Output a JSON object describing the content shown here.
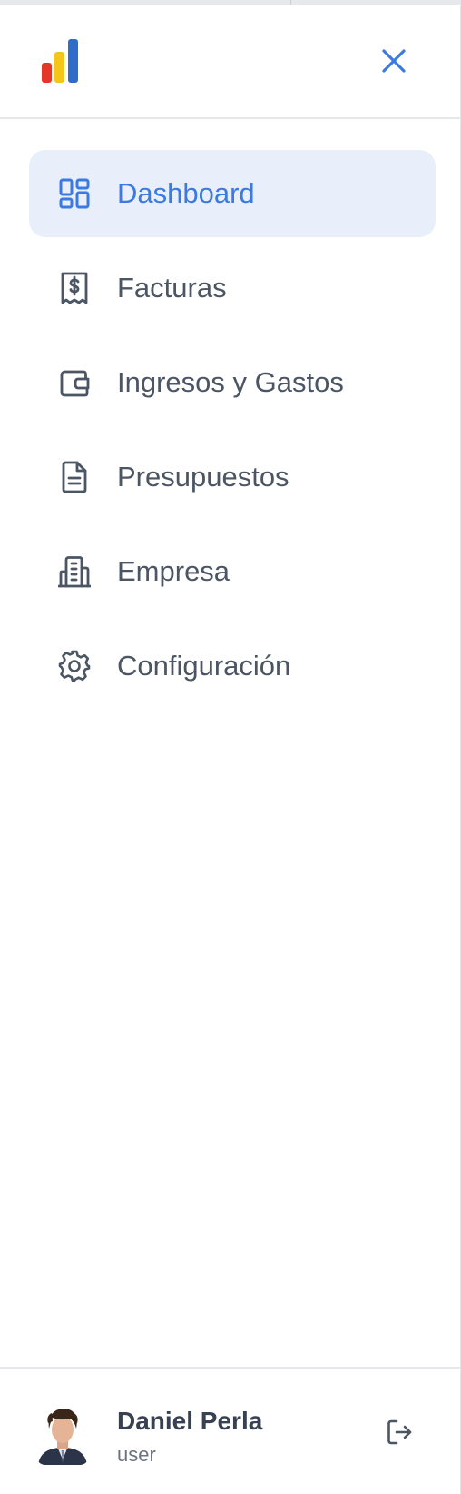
{
  "brand": {
    "logo_icon": "bar-chart-logo-icon",
    "colors": {
      "red": "#e53727",
      "yellow": "#f5c518",
      "blue": "#2f6dc6"
    }
  },
  "header": {
    "close_icon": "close-icon"
  },
  "theme": {
    "accent": "#3b7ae0",
    "active_bg": "#e8effb",
    "text": "#4b5563",
    "divider": "#e5e7eb"
  },
  "nav": {
    "items": [
      {
        "label": "Dashboard",
        "icon": "dashboard-grid-icon",
        "active": true
      },
      {
        "label": "Facturas",
        "icon": "receipt-dollar-icon",
        "active": false
      },
      {
        "label": "Ingresos y Gastos",
        "icon": "wallet-icon",
        "active": false
      },
      {
        "label": "Presupuestos",
        "icon": "document-icon",
        "active": false
      },
      {
        "label": "Empresa",
        "icon": "building-icon",
        "active": false
      },
      {
        "label": "Configuración",
        "icon": "gear-icon",
        "active": false
      }
    ]
  },
  "user": {
    "name": "Daniel Perla",
    "role": "user",
    "avatar_icon": "avatar-photo",
    "logout_icon": "logout-icon"
  }
}
